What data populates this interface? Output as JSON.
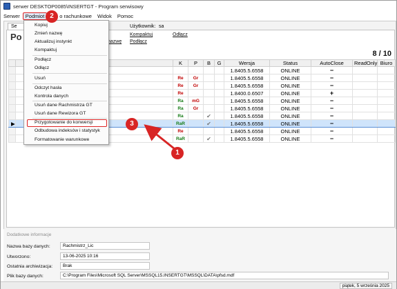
{
  "window": {
    "title": "serwer DESKTOP0085\\INSERTGT - Program serwisowy"
  },
  "menubar": {
    "items": [
      "Serwer",
      "Podmiot",
      "o rachunkowe",
      "Widok",
      "Pomoc"
    ]
  },
  "header": {
    "tab_label": "Se",
    "big_title": "Po",
    "user_label": "Użytkownik:",
    "user_value": "sa",
    "links": {
      "kompaktuj": "Kompaktuj",
      "odlacz": "Odłącz",
      "podlacz": "Podłącz",
      "nazwe": "nazwę"
    },
    "counter": "8 / 10"
  },
  "table": {
    "columns": [
      "K",
      "P",
      "B",
      "G",
      "Wersja",
      "Status",
      "AutoClose",
      "ReadOnly",
      "Biuro"
    ],
    "rows": [
      {
        "k": "",
        "p": "",
        "b": "",
        "g": "",
        "wersja": "1.8405.5.6558",
        "status": "ONLINE",
        "autoclose": "−",
        "pointer": ""
      },
      {
        "k": "Re",
        "p": "Gr",
        "b": "",
        "g": "",
        "wersja": "1.8405.5.6558",
        "status": "ONLINE",
        "autoclose": "−",
        "pointer": ""
      },
      {
        "k": "Re",
        "p": "Gr",
        "b": "",
        "g": "",
        "wersja": "1.8405.5.6558",
        "status": "ONLINE",
        "autoclose": "−",
        "pointer": ""
      },
      {
        "k": "Re",
        "p": "",
        "b": "",
        "g": "",
        "wersja": "1.8400.0.6507",
        "status": "ONLINE",
        "autoclose": "+",
        "pointer": ""
      },
      {
        "k": "Ra",
        "p": "mG",
        "b": "",
        "g": "",
        "wersja": "1.8405.5.6558",
        "status": "ONLINE",
        "autoclose": "−",
        "pointer": ""
      },
      {
        "k": "Ra",
        "p": "Gr",
        "b": "",
        "g": "",
        "wersja": "1.8405.5.6558",
        "status": "ONLINE",
        "autoclose": "−",
        "pointer": ""
      },
      {
        "k": "Ra",
        "p": "",
        "b": "✔",
        "g": "",
        "wersja": "1.8405.5.6558",
        "status": "ONLINE",
        "autoclose": "−",
        "pointer": ""
      },
      {
        "k": "RaR",
        "p": "",
        "b": "✔",
        "g": "",
        "wersja": "1.8405.5.6558",
        "status": "ONLINE",
        "autoclose": "−",
        "pointer": "▶"
      },
      {
        "k": "Re",
        "p": "",
        "b": "",
        "g": "",
        "wersja": "1.8405.5.6558",
        "status": "ONLINE",
        "autoclose": "−",
        "pointer": ""
      },
      {
        "k": "RaR",
        "p": "",
        "b": "✔",
        "g": "",
        "wersja": "1.8405.5.6558",
        "status": "ONLINE",
        "autoclose": "−",
        "pointer": ""
      }
    ]
  },
  "context_menu": {
    "items": [
      "Kopiuj",
      "Zmień nazwę",
      "Aktualizuj instynkt",
      "Kompaktuj",
      "Podłącz",
      "Odłącz",
      "Usuń",
      "Odczyt hasła",
      "Kontrola danych",
      "Usuń dane Rachmistrza GT",
      "Usuń dane Rewizora GT",
      "Przygotowanie do konwersji",
      "Odbudowa indeksów i statystyk",
      "Formatowanie warunkowe"
    ]
  },
  "details": {
    "header": "Dodatkowe informacje",
    "fields": [
      {
        "label": "Nazwa bazy danych:",
        "value": "Rachmistrz_Lic"
      },
      {
        "label": "Utworzono:",
        "value": "13-06-2025 10:16"
      },
      {
        "label": "Ostatnia archiwizacja:",
        "value": "Brak"
      },
      {
        "label": "Plik bazy danych:",
        "value": "C:\\Program Files\\Microsoft SQL Server\\MSSQL15.INSERTGT\\MSSQL\\DATA\\pfsd.mdf"
      }
    ]
  },
  "statusbar": {
    "date": "piątek, 5 września 2025"
  },
  "annotations": {
    "badge_1": "1",
    "badge_2": "2",
    "badge_3": "3",
    "color": "#d82525"
  }
}
